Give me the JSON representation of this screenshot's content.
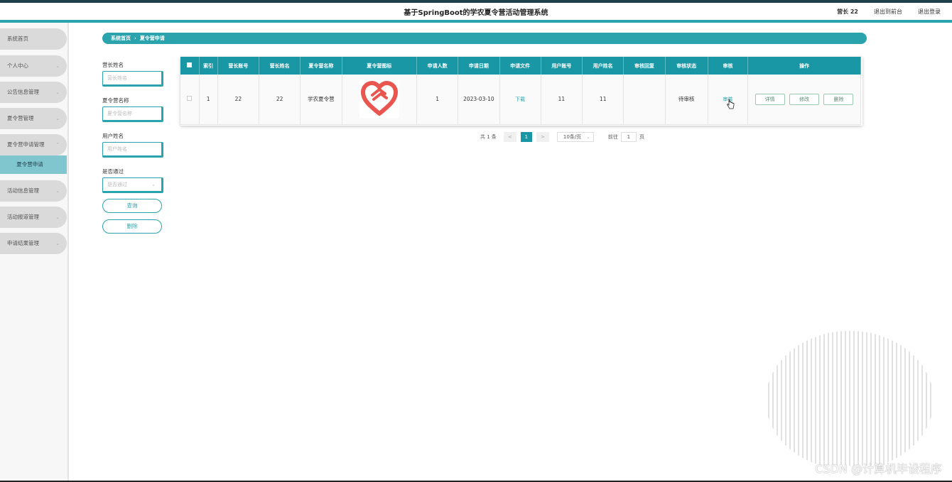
{
  "header": {
    "title": "基于SpringBoot的学农夏令营活动管理系统",
    "user": "营长 22",
    "to_front": "退出到前台",
    "logout": "退出登录"
  },
  "sidebar": {
    "items": [
      {
        "label": "系统首页"
      },
      {
        "label": "个人中心"
      },
      {
        "label": "公告信息管理"
      },
      {
        "label": "夏令营管理"
      },
      {
        "label": "夏令营申请管理"
      },
      {
        "label": "活动信息管理"
      },
      {
        "label": "活动报道管理"
      },
      {
        "label": "申请结果管理"
      }
    ],
    "sub_item": "夏令营申请"
  },
  "breadcrumb": {
    "home": "系统首页",
    "sep": "›",
    "current": "夏令营申请"
  },
  "filters": {
    "leader_name_label": "营长姓名",
    "leader_name_placeholder": "营长姓名",
    "camp_name_label": "夏令营名称",
    "camp_name_placeholder": "夏令营名称",
    "user_name_label": "用户姓名",
    "user_name_placeholder": "用户姓名",
    "passed_label": "是否通过",
    "passed_placeholder": "是否通过",
    "query_button": "查询",
    "delete_button": "删除"
  },
  "table": {
    "headers": [
      "索引",
      "营长账号",
      "营长姓名",
      "夏令营名称",
      "夏令营图标",
      "申请人数",
      "申请日期",
      "申请文件",
      "用户账号",
      "用户姓名",
      "审核回复",
      "审核状态",
      "审核",
      "操作"
    ],
    "rows": [
      {
        "index": "1",
        "leader_account": "22",
        "leader_name": "22",
        "camp_name": "学农夏令营",
        "applicants": "1",
        "apply_date": "2023-03-10",
        "file": "下载",
        "user_account": "11",
        "user_name": "11",
        "reply": "",
        "status": "待审核",
        "audit": "审核",
        "op_detail": "详情",
        "op_edit": "修改",
        "op_delete": "删除"
      }
    ]
  },
  "pagination": {
    "total": "共 1 条",
    "prev": "<",
    "page": "1",
    "next": ">",
    "page_size": "10条/页",
    "goto_label": "前往",
    "goto_value": "1",
    "goto_unit": "页"
  },
  "watermark": "CSDN @计算机毕设程序",
  "colors": {
    "accent": "#2aa3ad",
    "table_header": "#1a97a5",
    "icon_heart": "#e8564f"
  }
}
